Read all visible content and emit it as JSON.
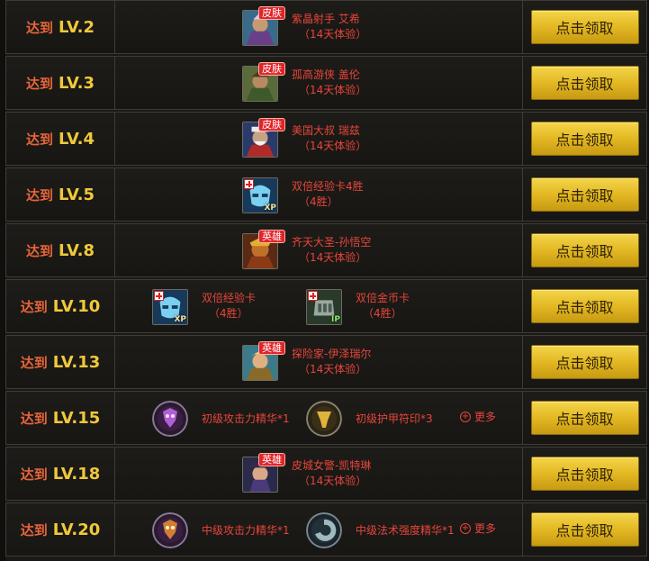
{
  "colors": {
    "level_prefix": "#e8653a",
    "level_value": "#f0c83a",
    "reward_text": "#e8453a",
    "button": "#e3b823",
    "tag": "#e0242a"
  },
  "button_label": "点击领取",
  "rows": [
    {
      "prefix": "达到",
      "level": "LV.2",
      "rewards": [
        {
          "icon": "hero-skin-portrait-icon",
          "tag": "皮肤",
          "name": "紫晶射手 艾希",
          "detail": "（14天体验）"
        }
      ]
    },
    {
      "prefix": "达到",
      "level": "LV.3",
      "rewards": [
        {
          "icon": "hero-skin-portrait-icon",
          "tag": "皮肤",
          "name": "孤高游侠 盖伦",
          "detail": "（14天体验）"
        }
      ]
    },
    {
      "prefix": "达到",
      "level": "LV.4",
      "rewards": [
        {
          "icon": "hero-skin-portrait-icon",
          "tag": "皮肤",
          "name": "美国大叔 瑞兹",
          "detail": "（14天体验）"
        }
      ]
    },
    {
      "prefix": "达到",
      "level": "LV.5",
      "rewards": [
        {
          "icon": "double-xp-card-icon",
          "name": "双倍经验卡4胜",
          "detail": "（4胜）"
        }
      ]
    },
    {
      "prefix": "达到",
      "level": "LV.8",
      "rewards": [
        {
          "icon": "hero-portrait-icon",
          "tag": "英雄",
          "name": "齐天大圣-孙悟空",
          "detail": "（14天体验）"
        }
      ]
    },
    {
      "prefix": "达到",
      "level": "LV.10",
      "rewards": [
        {
          "icon": "double-xp-card-icon",
          "name": "双倍经验卡",
          "detail": "（4胜）"
        },
        {
          "icon": "double-ip-card-icon",
          "name": "双倍金币卡",
          "detail": "（4胜）"
        }
      ]
    },
    {
      "prefix": "达到",
      "level": "LV.13",
      "rewards": [
        {
          "icon": "hero-portrait-icon",
          "tag": "英雄",
          "name": "探险家-伊泽瑞尔",
          "detail": "（14天体验）"
        }
      ]
    },
    {
      "prefix": "达到",
      "level": "LV.15",
      "more": "更多",
      "rewards": [
        {
          "icon": "rune-essence-icon",
          "name": "初级攻击力精华*1"
        },
        {
          "icon": "rune-seal-icon",
          "name": "初级护甲符印*3"
        }
      ]
    },
    {
      "prefix": "达到",
      "level": "LV.18",
      "rewards": [
        {
          "icon": "hero-portrait-icon",
          "tag": "英雄",
          "name": "皮城女警-凯特琳",
          "detail": "（14天体验）"
        }
      ]
    },
    {
      "prefix": "达到",
      "level": "LV.20",
      "more": "更多",
      "rewards": [
        {
          "icon": "rune-essence-icon",
          "name": "中级攻击力精华*1"
        },
        {
          "icon": "rune-glyph-icon",
          "name": "中级法术强度精华*1"
        }
      ]
    }
  ]
}
